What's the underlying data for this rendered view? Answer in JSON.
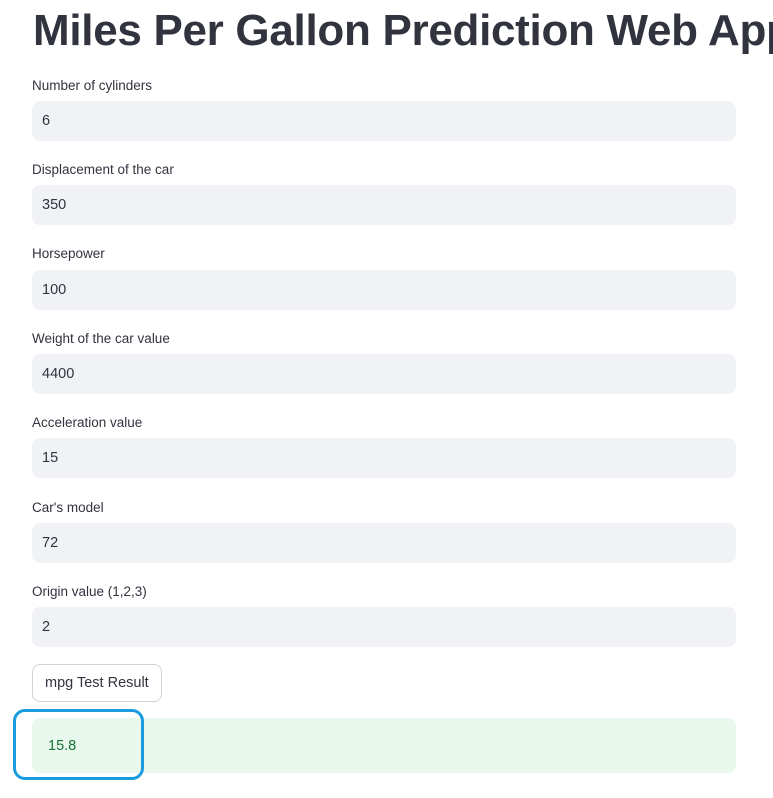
{
  "app": {
    "title": "Miles Per Gallon Prediction Web App"
  },
  "fields": [
    {
      "label": "Number of cylinders",
      "value": "6"
    },
    {
      "label": "Displacement of the car",
      "value": "350"
    },
    {
      "label": "Horsepower",
      "value": "100"
    },
    {
      "label": "Weight of the car value",
      "value": "4400"
    },
    {
      "label": "Acceleration value",
      "value": "15"
    },
    {
      "label": "Car's model",
      "value": "72"
    },
    {
      "label": "Origin value (1,2,3)",
      "value": "2"
    }
  ],
  "button": {
    "label": "mpg Test Result"
  },
  "result": {
    "value": "15.8"
  },
  "colors": {
    "text": "#31333f",
    "input_bg": "#f0f2f6",
    "success_bg": "#e8f8ec",
    "success_text": "#177233",
    "highlight": "#1a9be0"
  }
}
